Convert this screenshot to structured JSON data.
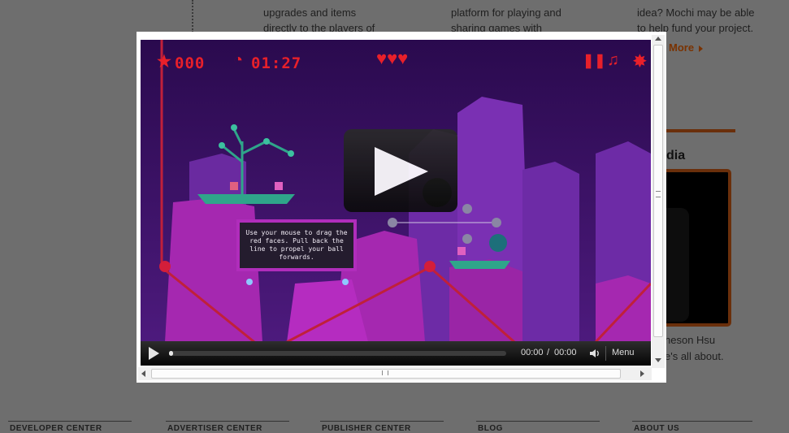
{
  "background": {
    "col1": [
      "upgrades and items",
      "directly to the players of"
    ],
    "col2": [
      "platform for playing and",
      "sharing games with"
    ],
    "col3": [
      "idea? Mochi may be able",
      "to help fund your project."
    ],
    "more_label": "More",
    "heading_fragment": "dia",
    "author_line1": "neson Hsu",
    "author_line2": "e's all about.",
    "footer_labels": [
      "DEVELOPER CENTER",
      "ADVERTISER CENTER",
      "PUBLISHER CENTER",
      "BLOG",
      "ABOUT US"
    ]
  },
  "game": {
    "score": "000",
    "timer": "01:27",
    "lives": "♥♥♥",
    "star_icon": "★",
    "clock_icon": "◔",
    "pause_icon": "❚❚",
    "music_icon": "♫",
    "settings_icon": "✸",
    "tooltip": "Use your mouse to drag the red faces. Pull back the line to propel your ball forwards."
  },
  "player": {
    "current_time": "00:00",
    "separator": "/",
    "duration": "00:00",
    "menu_label": "Menu",
    "progress": 0.01
  },
  "colors": {
    "hud_red": "#e8202a",
    "sky_purple": "#3b1165",
    "pillar_magenta": "#a528b0",
    "leaf_green": "#2fa58a"
  }
}
